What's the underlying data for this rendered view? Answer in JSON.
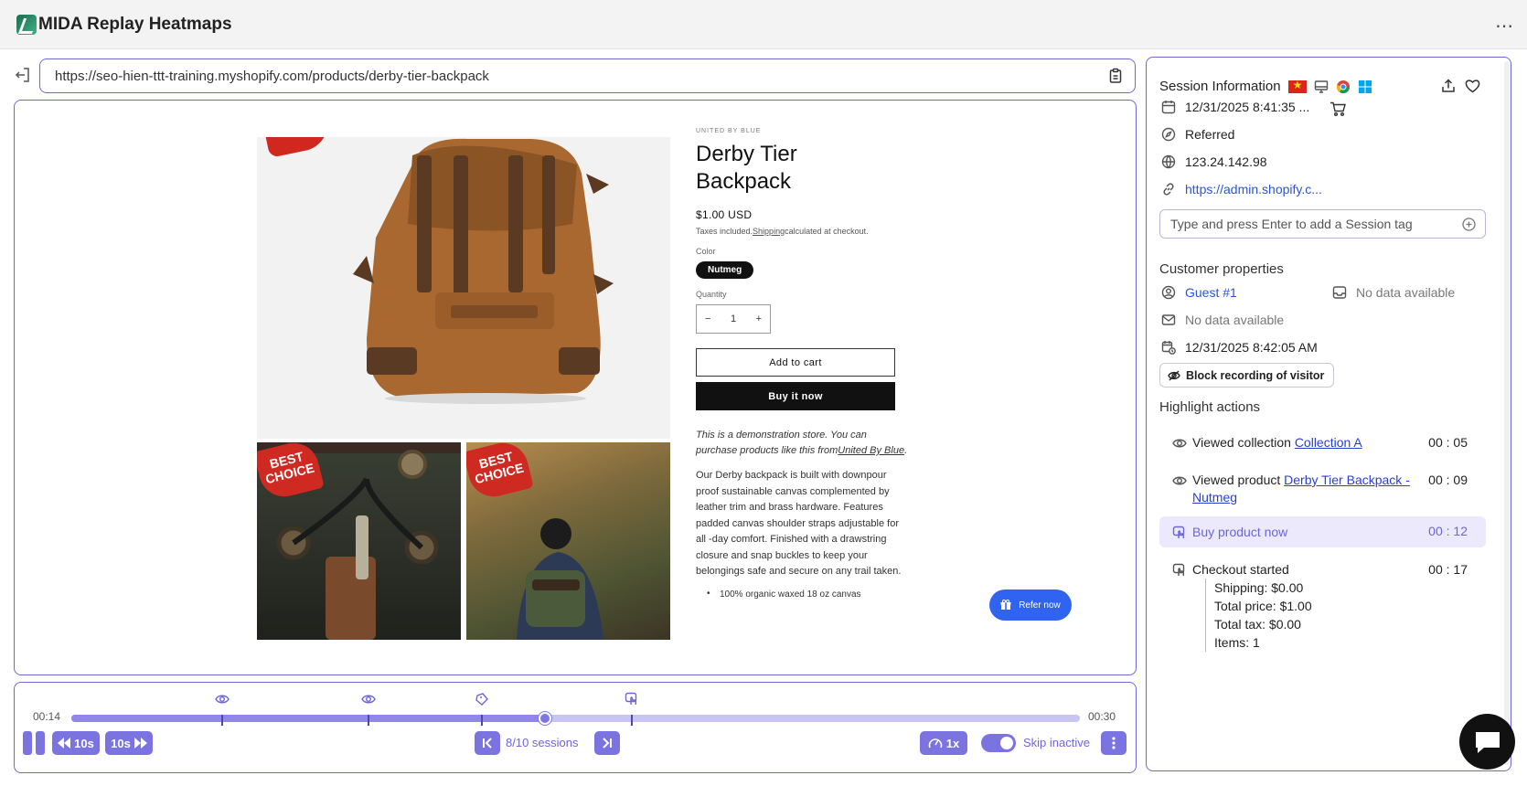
{
  "app": {
    "title": "MIDA Replay Heatmaps",
    "more": "⋯"
  },
  "url": "https://seo-hien-ttt-training.myshopify.com/products/derby-tier-backpack",
  "product": {
    "vendor": "UNITED BY BLUE",
    "title_line1": "Derby Tier",
    "title_line2": "Backpack",
    "price": "$1.00 USD",
    "tax_pre": "Taxes included.",
    "tax_link": "Shipping",
    "tax_post": "calculated at checkout.",
    "color_label": "Color",
    "color_value": "Nutmeg",
    "quantity_label": "Quantity",
    "qty_minus": "−",
    "qty_value": "1",
    "qty_plus": "+",
    "add_to_cart": "Add to cart",
    "buy_now": "Buy it now",
    "demo_text": "This is a demonstration store. You can purchase products like this from",
    "demo_link": "United By Blue",
    "demo_end": ".",
    "description": "Our Derby backpack is built with downpour proof sustainable canvas complemented by leather trim and brass hardware. Features padded canvas shoulder straps adjustable for all -day comfort. Finished with a drawstring closure and snap buckles to keep your belongings safe and secure on any trail taken.",
    "bullet1": "100% organic waxed 18 oz canvas",
    "badge_line1": "BEST",
    "badge_line2": "CHOICE"
  },
  "refer": {
    "label": "Refer now"
  },
  "player": {
    "time_current": "00:14",
    "time_total": "00:30",
    "progress": 0.47,
    "events": [
      {
        "type": "view",
        "at": 0.15
      },
      {
        "type": "view",
        "at": 0.295
      },
      {
        "type": "cart",
        "at": 0.407
      },
      {
        "type": "click",
        "at": 0.556
      }
    ],
    "rewind_label": "10s",
    "forward_label": "10s",
    "sessions_label": "8/10 sessions",
    "speed_label": "1x",
    "skip_inactive_label": "Skip inactive",
    "skip_inactive_on": true
  },
  "session": {
    "title": "Session Information",
    "datetime": "12/31/2025 8:41:35 ...",
    "source": "Referred",
    "ip": "123.24.142.98",
    "referrer": "https://admin.shopify.c...",
    "tag_placeholder": "Type and press Enter to add a Session tag"
  },
  "customer": {
    "title": "Customer properties",
    "name": "Guest #1",
    "field_right": "No data available",
    "email": "No data available",
    "last_seen": "12/31/2025 8:42:05 AM",
    "block_label": "Block recording of visitor"
  },
  "highlights": {
    "title": "Highlight actions",
    "items": [
      {
        "text": "Viewed collection ",
        "link": "Collection A",
        "time": "00 : 05"
      },
      {
        "text": "Viewed product ",
        "link": "Derby Tier Backpack - Nutmeg",
        "time": "00 : 09"
      },
      {
        "text": "Buy product now",
        "time": "00 : 12"
      },
      {
        "text": "Checkout started",
        "time": "00 : 17"
      }
    ],
    "checkout_details": [
      "Shipping: $0.00",
      "Total price: $1.00",
      "Total tax: $0.00",
      "Items: 1"
    ]
  },
  "colors": {
    "accent": "#7b73e0",
    "border": "#6d68d8",
    "refer": "#2f63f0",
    "link": "#2a56d6"
  }
}
